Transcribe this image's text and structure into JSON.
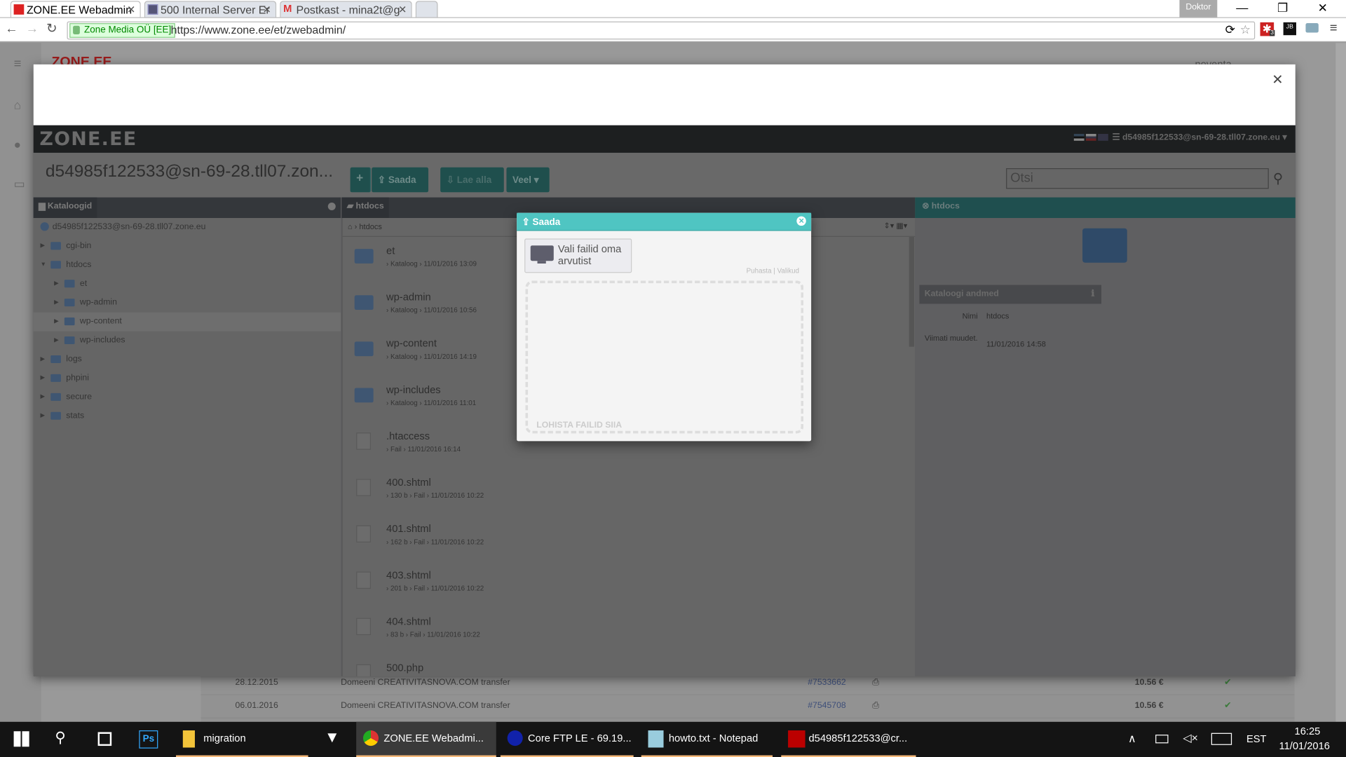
{
  "browser": {
    "tabs": [
      {
        "label": "ZONE.EE Webadmin",
        "icon": "zone-favicon",
        "active": true
      },
      {
        "label": "500 Internal Server Er",
        "icon": "grid-favicon"
      },
      {
        "label": "Postkast - mina2t@g",
        "icon": "gmail-favicon"
      }
    ],
    "profile": "Doktor",
    "security_label": "Zone Media OÜ [EE]",
    "url": "https://www.zone.ee/et/zwebadmin/",
    "extension_badge": "3",
    "extension_jb": "JB"
  },
  "underlying": {
    "logo": "ZONE.EE",
    "account": "noventa",
    "rows": [
      {
        "date": "28.12.2015",
        "desc": "Domeeni CREATIVITASNOVA.COM transfer",
        "invoice": "#7533662",
        "amount": "10.56 €"
      },
      {
        "date": "06.01.2016",
        "desc": "Domeeni CREATIVITASNOVA.COM transfer",
        "invoice": "#7545708",
        "amount": "10.56 €"
      }
    ]
  },
  "webadmin": {
    "logo": "ZONE.EE",
    "user": "d54985f122533@sn-69-28.tll07.zone.eu",
    "title": "d54985f122533@sn-69-28.tll07.zon...",
    "buttons": {
      "add": "+",
      "upload": "Saada",
      "download": "Lae alla",
      "more": "Veel"
    },
    "search_placeholder": "Otsi",
    "left_panel": {
      "title": "Kataloogid",
      "root": "d54985f122533@sn-69-28.tll07.zone.eu",
      "items": [
        {
          "label": "cgi-bin",
          "level": 0,
          "expanded": false
        },
        {
          "label": "htdocs",
          "level": 0,
          "expanded": true
        },
        {
          "label": "et",
          "level": 1,
          "expanded": false
        },
        {
          "label": "wp-admin",
          "level": 1,
          "expanded": false
        },
        {
          "label": "wp-content",
          "level": 1,
          "expanded": false,
          "selected": true
        },
        {
          "label": "wp-includes",
          "level": 1,
          "expanded": false
        },
        {
          "label": "logs",
          "level": 0,
          "expanded": false
        },
        {
          "label": "phpini",
          "level": 0,
          "expanded": false
        },
        {
          "label": "secure",
          "level": 0,
          "expanded": false
        },
        {
          "label": "stats",
          "level": 0,
          "expanded": false
        }
      ]
    },
    "mid_panel": {
      "title": "htdocs",
      "breadcrumb": "htdocs",
      "files": [
        {
          "name": "et",
          "type": "folder",
          "meta": "› Kataloog › 11/01/2016 13:09"
        },
        {
          "name": "wp-admin",
          "type": "folder",
          "meta": "› Kataloog › 11/01/2016 10:56"
        },
        {
          "name": "wp-content",
          "type": "folder",
          "meta": "› Kataloog › 11/01/2016 14:19"
        },
        {
          "name": "wp-includes",
          "type": "folder",
          "meta": "› Kataloog › 11/01/2016 11:01"
        },
        {
          "name": ".htaccess",
          "type": "file",
          "meta": "› Fail › 11/01/2016 16:14"
        },
        {
          "name": "400.shtml",
          "type": "file",
          "meta": "› 130 b › Fail › 11/01/2016 10:22"
        },
        {
          "name": "401.shtml",
          "type": "file",
          "meta": "› 162 b › Fail › 11/01/2016 10:22"
        },
        {
          "name": "403.shtml",
          "type": "file",
          "meta": "› 201 b › Fail › 11/01/2016 10:22"
        },
        {
          "name": "404.shtml",
          "type": "file",
          "meta": "› 83 b › Fail › 11/01/2016 10:22"
        },
        {
          "name": "500.php",
          "type": "file",
          "meta": ""
        }
      ]
    },
    "right_panel": {
      "title": "htdocs",
      "section": "Kataloogi andmed",
      "name_label": "Nimi",
      "name_value": "htdocs",
      "modified_label": "Viimati muudet.",
      "modified_value": "11/01/2016 14:58"
    }
  },
  "modal": {
    "title": "Saada",
    "pick_label": "Vali failid oma arvutist",
    "clear": "Puhasta",
    "options": "Valikud",
    "drop_label": "LOHISTA FAILID SIIA",
    "accent": "#4fc5c2"
  },
  "taskbar": {
    "items": [
      {
        "label": "migration",
        "icon": "folder-icon"
      },
      {
        "label": "ZONE.EE Webadmi...",
        "icon": "chrome-icon",
        "active": true
      },
      {
        "label": "Core FTP LE - 69.19...",
        "icon": "coreftp-icon"
      },
      {
        "label": "howto.txt - Notepad",
        "icon": "notepad-icon"
      },
      {
        "label": "d54985f122533@cr...",
        "icon": "filezilla-icon"
      }
    ],
    "language": "EST",
    "time": "16:25",
    "date": "11/01/2016"
  }
}
